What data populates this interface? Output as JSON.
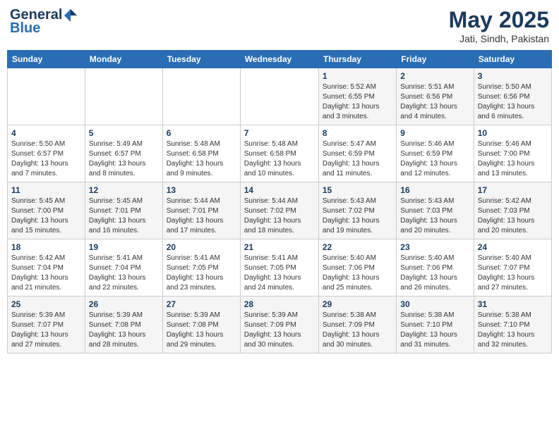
{
  "header": {
    "logo_general": "General",
    "logo_blue": "Blue",
    "month": "May 2025",
    "location": "Jati, Sindh, Pakistan"
  },
  "weekdays": [
    "Sunday",
    "Monday",
    "Tuesday",
    "Wednesday",
    "Thursday",
    "Friday",
    "Saturday"
  ],
  "weeks": [
    [
      {
        "day": "",
        "info": ""
      },
      {
        "day": "",
        "info": ""
      },
      {
        "day": "",
        "info": ""
      },
      {
        "day": "",
        "info": ""
      },
      {
        "day": "1",
        "info": "Sunrise: 5:52 AM\nSunset: 6:55 PM\nDaylight: 13 hours\nand 3 minutes."
      },
      {
        "day": "2",
        "info": "Sunrise: 5:51 AM\nSunset: 6:56 PM\nDaylight: 13 hours\nand 4 minutes."
      },
      {
        "day": "3",
        "info": "Sunrise: 5:50 AM\nSunset: 6:56 PM\nDaylight: 13 hours\nand 6 minutes."
      }
    ],
    [
      {
        "day": "4",
        "info": "Sunrise: 5:50 AM\nSunset: 6:57 PM\nDaylight: 13 hours\nand 7 minutes."
      },
      {
        "day": "5",
        "info": "Sunrise: 5:49 AM\nSunset: 6:57 PM\nDaylight: 13 hours\nand 8 minutes."
      },
      {
        "day": "6",
        "info": "Sunrise: 5:48 AM\nSunset: 6:58 PM\nDaylight: 13 hours\nand 9 minutes."
      },
      {
        "day": "7",
        "info": "Sunrise: 5:48 AM\nSunset: 6:58 PM\nDaylight: 13 hours\nand 10 minutes."
      },
      {
        "day": "8",
        "info": "Sunrise: 5:47 AM\nSunset: 6:59 PM\nDaylight: 13 hours\nand 11 minutes."
      },
      {
        "day": "9",
        "info": "Sunrise: 5:46 AM\nSunset: 6:59 PM\nDaylight: 13 hours\nand 12 minutes."
      },
      {
        "day": "10",
        "info": "Sunrise: 5:46 AM\nSunset: 7:00 PM\nDaylight: 13 hours\nand 13 minutes."
      }
    ],
    [
      {
        "day": "11",
        "info": "Sunrise: 5:45 AM\nSunset: 7:00 PM\nDaylight: 13 hours\nand 15 minutes."
      },
      {
        "day": "12",
        "info": "Sunrise: 5:45 AM\nSunset: 7:01 PM\nDaylight: 13 hours\nand 16 minutes."
      },
      {
        "day": "13",
        "info": "Sunrise: 5:44 AM\nSunset: 7:01 PM\nDaylight: 13 hours\nand 17 minutes."
      },
      {
        "day": "14",
        "info": "Sunrise: 5:44 AM\nSunset: 7:02 PM\nDaylight: 13 hours\nand 18 minutes."
      },
      {
        "day": "15",
        "info": "Sunrise: 5:43 AM\nSunset: 7:02 PM\nDaylight: 13 hours\nand 19 minutes."
      },
      {
        "day": "16",
        "info": "Sunrise: 5:43 AM\nSunset: 7:03 PM\nDaylight: 13 hours\nand 20 minutes."
      },
      {
        "day": "17",
        "info": "Sunrise: 5:42 AM\nSunset: 7:03 PM\nDaylight: 13 hours\nand 20 minutes."
      }
    ],
    [
      {
        "day": "18",
        "info": "Sunrise: 5:42 AM\nSunset: 7:04 PM\nDaylight: 13 hours\nand 21 minutes."
      },
      {
        "day": "19",
        "info": "Sunrise: 5:41 AM\nSunset: 7:04 PM\nDaylight: 13 hours\nand 22 minutes."
      },
      {
        "day": "20",
        "info": "Sunrise: 5:41 AM\nSunset: 7:05 PM\nDaylight: 13 hours\nand 23 minutes."
      },
      {
        "day": "21",
        "info": "Sunrise: 5:41 AM\nSunset: 7:05 PM\nDaylight: 13 hours\nand 24 minutes."
      },
      {
        "day": "22",
        "info": "Sunrise: 5:40 AM\nSunset: 7:06 PM\nDaylight: 13 hours\nand 25 minutes."
      },
      {
        "day": "23",
        "info": "Sunrise: 5:40 AM\nSunset: 7:06 PM\nDaylight: 13 hours\nand 26 minutes."
      },
      {
        "day": "24",
        "info": "Sunrise: 5:40 AM\nSunset: 7:07 PM\nDaylight: 13 hours\nand 27 minutes."
      }
    ],
    [
      {
        "day": "25",
        "info": "Sunrise: 5:39 AM\nSunset: 7:07 PM\nDaylight: 13 hours\nand 27 minutes."
      },
      {
        "day": "26",
        "info": "Sunrise: 5:39 AM\nSunset: 7:08 PM\nDaylight: 13 hours\nand 28 minutes."
      },
      {
        "day": "27",
        "info": "Sunrise: 5:39 AM\nSunset: 7:08 PM\nDaylight: 13 hours\nand 29 minutes."
      },
      {
        "day": "28",
        "info": "Sunrise: 5:39 AM\nSunset: 7:09 PM\nDaylight: 13 hours\nand 30 minutes."
      },
      {
        "day": "29",
        "info": "Sunrise: 5:38 AM\nSunset: 7:09 PM\nDaylight: 13 hours\nand 30 minutes."
      },
      {
        "day": "30",
        "info": "Sunrise: 5:38 AM\nSunset: 7:10 PM\nDaylight: 13 hours\nand 31 minutes."
      },
      {
        "day": "31",
        "info": "Sunrise: 5:38 AM\nSunset: 7:10 PM\nDaylight: 13 hours\nand 32 minutes."
      }
    ]
  ]
}
